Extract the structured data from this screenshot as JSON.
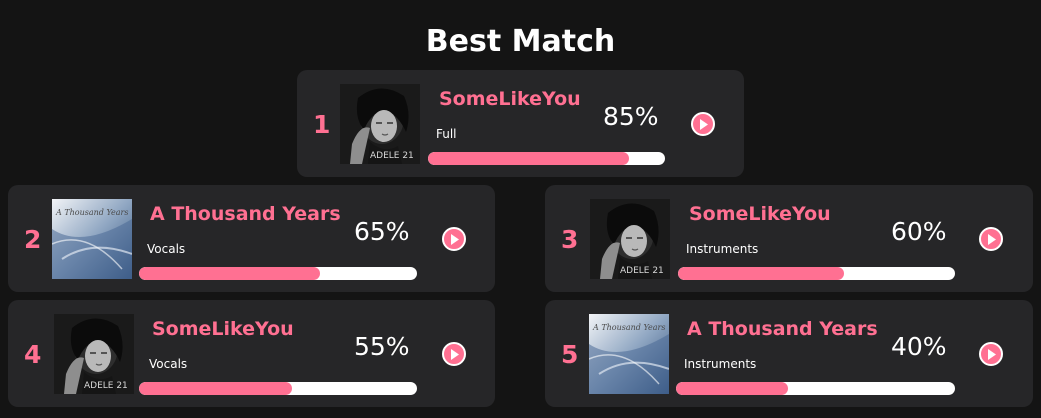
{
  "title": "Best Match",
  "accent": "#ff7092",
  "cards": [
    {
      "rank": "1",
      "song": "SomeLikeYou",
      "type": "Full",
      "percent": "85%",
      "match": 0.85,
      "cover": "adele-21-album-cover"
    },
    {
      "rank": "2",
      "song": "A Thousand Years",
      "type": "Vocals",
      "percent": "65%",
      "match": 0.65,
      "cover": "a-thousand-years-cover"
    },
    {
      "rank": "3",
      "song": "SomeLikeYou",
      "type": "Instruments",
      "percent": "60%",
      "match": 0.6,
      "cover": "adele-21-album-cover"
    },
    {
      "rank": "4",
      "song": "SomeLikeYou",
      "type": "Vocals",
      "percent": "55%",
      "match": 0.55,
      "cover": "adele-21-album-cover"
    },
    {
      "rank": "5",
      "song": "A Thousand Years",
      "type": "Instruments",
      "percent": "40%",
      "match": 0.4,
      "cover": "a-thousand-years-cover"
    }
  ],
  "cover_text": {
    "adele": "ADELE 21",
    "thousand": "A Thousand Years"
  },
  "icons": {
    "play": "play-icon"
  }
}
